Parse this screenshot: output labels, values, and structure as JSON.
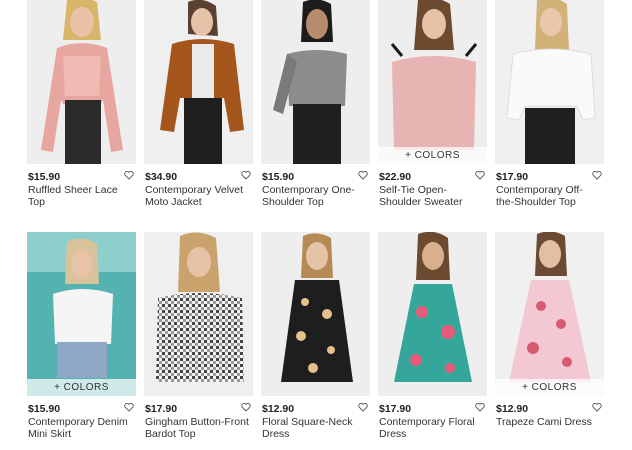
{
  "colors": {
    "background": "#ffffff",
    "text": "#222222",
    "overlay": "#ffffffb8"
  },
  "products": [
    {
      "price": "$15.90",
      "name": "Ruffled Sheer Lace Top",
      "more_colors": "",
      "image": "model-pink-ruffled-top"
    },
    {
      "price": "$34.90",
      "name": "Contemporary Velvet Moto Jacket",
      "more_colors": "",
      "image": "model-rust-velvet-jacket"
    },
    {
      "price": "$15.90",
      "name": "Contemporary One-Shoulder Top",
      "more_colors": "",
      "image": "model-metallic-top"
    },
    {
      "price": "$22.90",
      "name": "Self-Tie Open-Shoulder Sweater",
      "more_colors": "+ COLORS",
      "image": "model-pink-sweater"
    },
    {
      "price": "$17.90",
      "name": "Contemporary Off-the-Shoulder Top",
      "more_colors": "",
      "image": "model-white-offshoulder"
    },
    {
      "price": "$15.90",
      "name": "Contemporary Denim Mini Skirt",
      "more_colors": "+ COLORS",
      "image": "model-denim-skirt"
    },
    {
      "price": "$17.90",
      "name": "Gingham Button-Front Bardot Top",
      "more_colors": "",
      "image": "model-gingham-top"
    },
    {
      "price": "$12.90",
      "name": "Floral Square-Neck Dress",
      "more_colors": "",
      "image": "model-black-floral-dress"
    },
    {
      "price": "$17.90",
      "name": "Contemporary Floral Dress",
      "more_colors": "",
      "image": "model-tropical-dress"
    },
    {
      "price": "$12.90",
      "name": "Trapeze Cami Dress",
      "more_colors": "+ COLORS",
      "image": "model-pink-floral-cami"
    }
  ]
}
